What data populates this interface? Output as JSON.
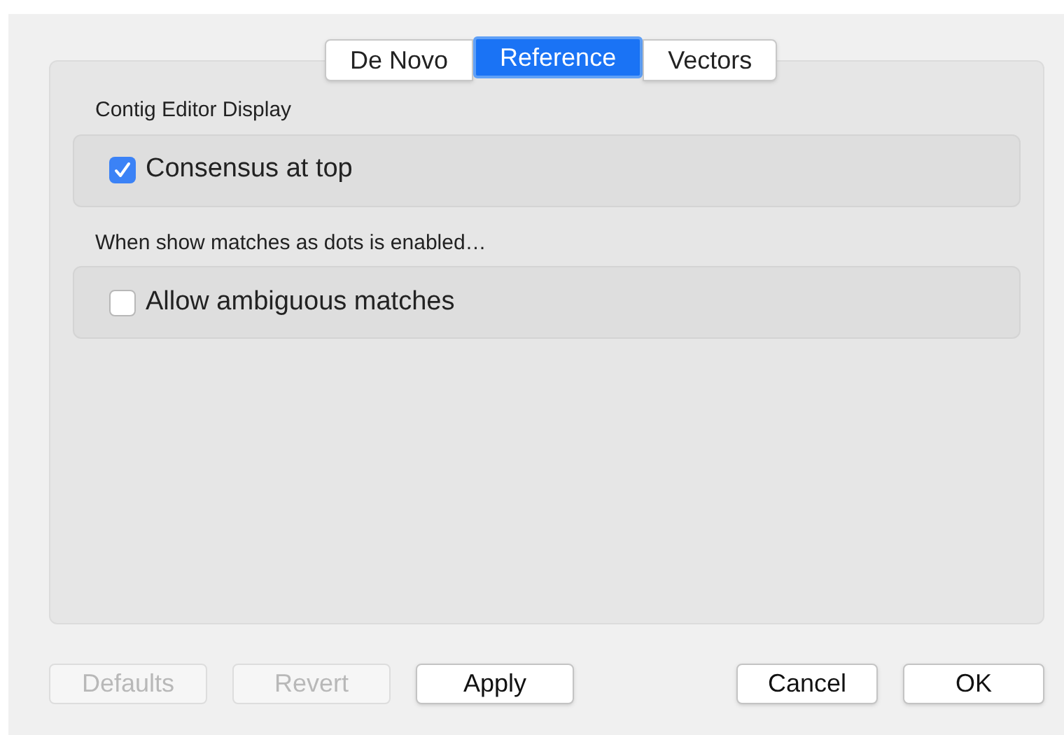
{
  "tabs": [
    {
      "label": "De Novo",
      "selected": false
    },
    {
      "label": "Reference",
      "selected": true
    },
    {
      "label": "Vectors",
      "selected": false
    }
  ],
  "groups": [
    {
      "title": "Contig Editor Display",
      "options": [
        {
          "label": "Consensus at top",
          "checked": true
        }
      ]
    },
    {
      "title": "When show matches as dots is enabled…",
      "options": [
        {
          "label": "Allow ambiguous matches",
          "checked": false
        }
      ]
    }
  ],
  "left_buttons": [
    {
      "label": "Defaults",
      "disabled": true
    },
    {
      "label": "Revert",
      "disabled": true
    },
    {
      "label": "Apply",
      "disabled": false
    }
  ],
  "right_buttons": [
    {
      "label": "Cancel",
      "disabled": false
    },
    {
      "label": "OK",
      "disabled": false
    }
  ]
}
